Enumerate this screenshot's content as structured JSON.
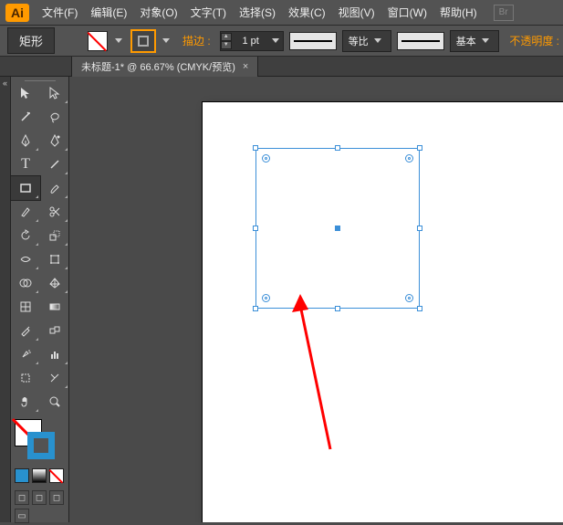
{
  "app": {
    "icon_text": "Ai"
  },
  "menu": {
    "file": "文件(F)",
    "edit": "编辑(E)",
    "object": "对象(O)",
    "type": "文字(T)",
    "select": "选择(S)",
    "effect": "效果(C)",
    "view": "视图(V)",
    "window": "窗口(W)",
    "help": "帮助(H)",
    "br": "Br"
  },
  "controlbar": {
    "shape_label": "矩形",
    "stroke_label": "描边 :",
    "stroke_value": "1 pt",
    "proportional_label": "等比",
    "style_label": "基本",
    "opacity_label": "不透明度 :"
  },
  "tab": {
    "title": "未标题-1* @ 66.67% (CMYK/预览)",
    "close": "×"
  },
  "left_strip": {
    "chev": "«"
  },
  "tools": {
    "selection": "selection",
    "direct_selection": "direct-selection",
    "magic_wand": "magic-wand",
    "lasso": "lasso",
    "pen": "pen",
    "curvature_pen": "curvature-pen",
    "type": "T",
    "line": "line",
    "rectangle": "rectangle",
    "paintbrush": "paintbrush",
    "pencil": "pencil",
    "scissors": "scissors",
    "rotate": "rotate",
    "scale": "scale",
    "width": "width",
    "free_transform": "free-transform",
    "shape_builder": "shape-builder",
    "perspective": "perspective",
    "mesh": "mesh",
    "gradient": "gradient",
    "eyedropper": "eyedropper",
    "blend": "blend",
    "symbol_sprayer": "symbol-sprayer",
    "column_graph": "column-graph",
    "artboard": "artboard",
    "slice": "slice",
    "hand": "hand",
    "zoom": "zoom"
  }
}
